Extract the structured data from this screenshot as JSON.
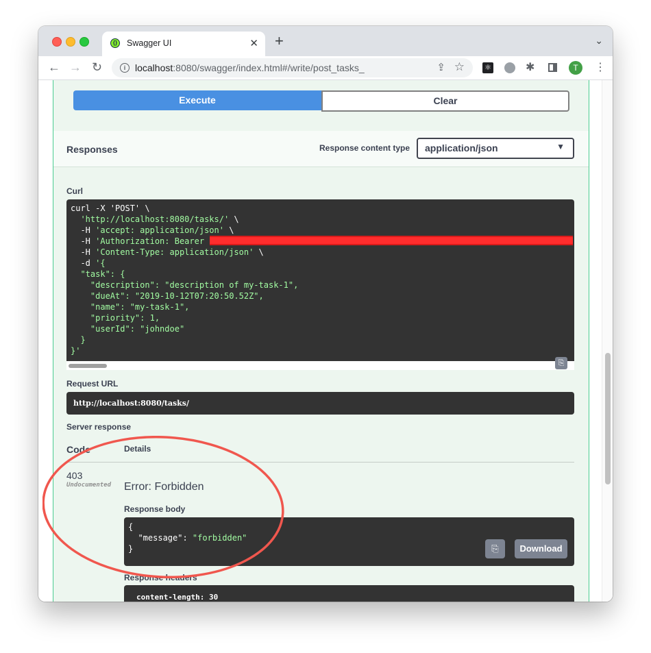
{
  "browser": {
    "tab_title": "Swagger UI",
    "tab_close": "✕",
    "new_tab": "+",
    "url_host": "localhost",
    "url_rest": ":8080/swagger/index.html#/write/post_tasks_",
    "avatar_letter": "T"
  },
  "actions": {
    "execute_label": "Execute",
    "clear_label": "Clear"
  },
  "responses": {
    "title": "Responses",
    "content_type_label": "Response content type",
    "content_type_value": "application/json"
  },
  "curl": {
    "label": "Curl",
    "line1": "curl -X 'POST' \\",
    "line2_str": "'http://localhost:8080/tasks/'",
    "line2_tail": " \\",
    "line3_flag": "  -H ",
    "line3_str": "'accept: application/json'",
    "line4_flag": "  -H ",
    "line4_str": "'Authorization: Bearer",
    "line5_flag": "  -H ",
    "line5_str": "'Content-Type: application/json'",
    "line6_flag": "  -d ",
    "line6_str": "'{",
    "body": "  \"task\": {\n    \"description\": \"description of my-task-1\",\n    \"dueAt\": \"2019-10-12T07:20:50.52Z\",\n    \"name\": \"my-task-1\",\n    \"priority\": 1,\n    \"userId\": \"johndoe\"\n  }\n}'"
  },
  "request_url": {
    "label": "Request URL",
    "value": "http://localhost:8080/tasks/"
  },
  "server_response": {
    "label": "Server response",
    "col_code": "Code",
    "col_details": "Details",
    "code": "403",
    "undocumented": "Undocumented",
    "error": "Error: Forbidden",
    "body_label": "Response body",
    "body_open": "{",
    "body_key": "  \"message\": ",
    "body_val": "\"forbidden\"",
    "body_close": "}",
    "download_label": "Download",
    "headers_label": "Response headers",
    "headers_first": "content-length: 30"
  },
  "colors": {
    "execute_bg": "#4990e2",
    "post_block_bg": "#edf6ef",
    "post_border": "#49cc90",
    "code_bg": "#333333",
    "string_green": "#a2fca2",
    "annotation_circle": "#f0574e",
    "redaction": "#ff2d2d"
  }
}
